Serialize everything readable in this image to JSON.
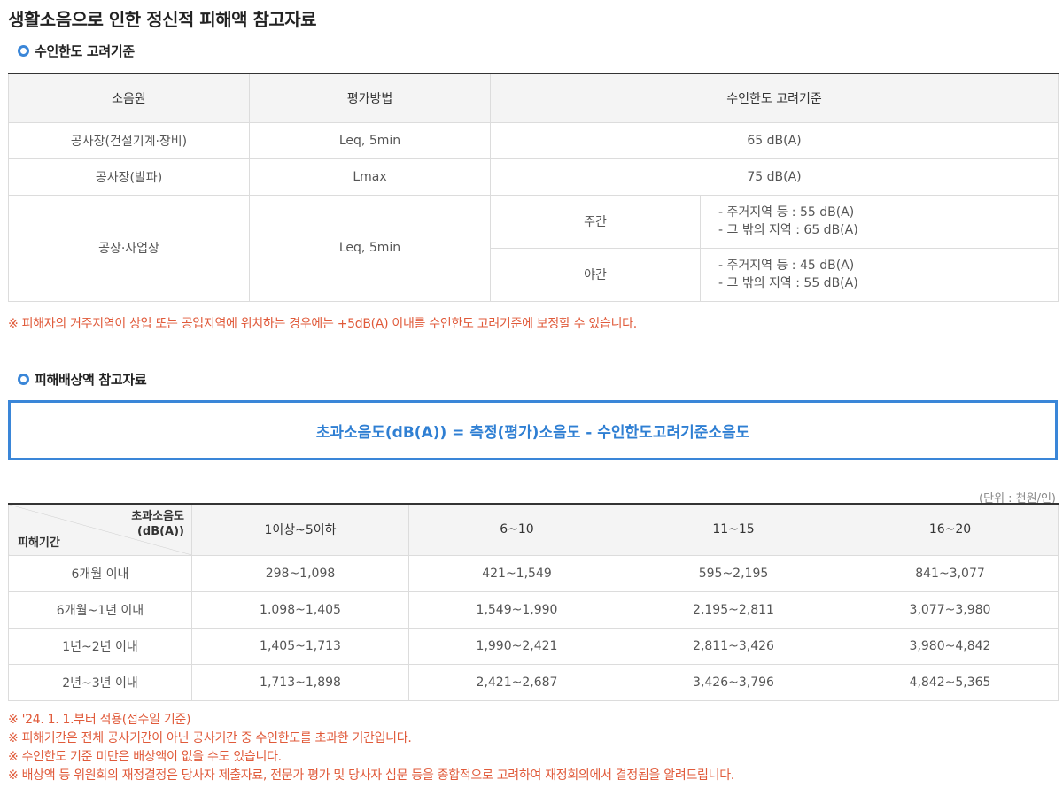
{
  "page_title": "생활소음으로 인한 정신적 피해액 참고자료",
  "section1": {
    "title": "수인한도 고려기준",
    "headers": [
      "소음원",
      "평가방법",
      "수인한도 고려기준"
    ],
    "rows": [
      {
        "source": "공사장(건설기계·장비)",
        "method": "Leq, 5min",
        "standard": "65 dB(A)"
      },
      {
        "source": "공사장(발파)",
        "method": "Lmax",
        "standard": "75 dB(A)"
      }
    ],
    "factory": {
      "source": "공장·사업장",
      "method": "Leq, 5min",
      "day_label": "주간",
      "day_line1": "- 주거지역 등 : 55 dB(A)",
      "day_line2": "- 그 밖의 지역 : 65 dB(A)",
      "night_label": "야간",
      "night_line1": "- 주거지역 등 : 45 dB(A)",
      "night_line2": "- 그 밖의 지역 : 55 dB(A)"
    },
    "note": "※ 피해자의 거주지역이 상업 또는 공업지역에 위치하는 경우에는 +5dB(A) 이내를 수인한도 고려기준에 보정할 수 있습니다."
  },
  "section2": {
    "title": "피해배상액 참고자료",
    "formula": "초과소음도(dB(A)) = 측정(평가)소음도 - 수인한도고려기준소음도",
    "unit": "(단위 : 천원/인)",
    "diag_top_line1": "초과소음도",
    "diag_top_line2": "(dB(A))",
    "diag_bottom": "피해기간",
    "col_headers": [
      "1이상~5이하",
      "6~10",
      "11~15",
      "16~20"
    ],
    "rows": [
      {
        "period": "6개월 이내",
        "values": [
          "298~1,098",
          "421~1,549",
          "595~2,195",
          "841~3,077"
        ]
      },
      {
        "period": "6개월~1년 이내",
        "values": [
          "1.098~1,405",
          "1,549~1,990",
          "2,195~2,811",
          "3,077~3,980"
        ]
      },
      {
        "period": "1년~2년 이내",
        "values": [
          "1,405~1,713",
          "1,990~2,421",
          "2,811~3,426",
          "3,980~4,842"
        ]
      },
      {
        "period": "2년~3년 이내",
        "values": [
          "1,713~1,898",
          "2,421~2,687",
          "3,426~3,796",
          "4,842~5,365"
        ]
      }
    ],
    "notes": [
      "※ '24. 1. 1.부터 적용(접수일 기준)",
      "※ 피해기간은 전체 공사기간이 아닌 공사기간 중 수인한도를 초과한 기간입니다.",
      "※ 수인한도 기준 미만은 배상액이 없을 수도 있습니다.",
      "※ 배상액 등 위원회의 재정결정은 당사자 제출자료, 전문가 평가 및 당사자 심문 등을 종합적으로 고려하여 재정회의에서 결정됨을 알려드립니다."
    ]
  },
  "colors": {
    "accent_blue": "#3a86d8",
    "note_red": "#e05a3a",
    "header_bg": "#f4f4f4"
  }
}
